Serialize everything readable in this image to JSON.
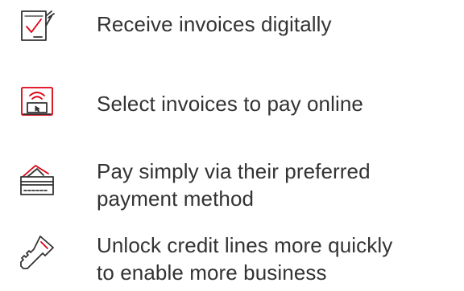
{
  "features": [
    {
      "icon": "checklist-document-icon",
      "text": "Receive invoices digitally"
    },
    {
      "icon": "wireless-laptop-icon",
      "text": "Select invoices to pay online"
    },
    {
      "icon": "credit-card-icon",
      "text": "Pay simply via their preferred",
      "text2": "payment method"
    },
    {
      "icon": "key-icon",
      "text": "Unlock credit lines more quickly",
      "text2": "to enable more business"
    }
  ],
  "colors": {
    "accent": "#db0011",
    "icon_stroke": "#333333",
    "text": "#333333"
  }
}
